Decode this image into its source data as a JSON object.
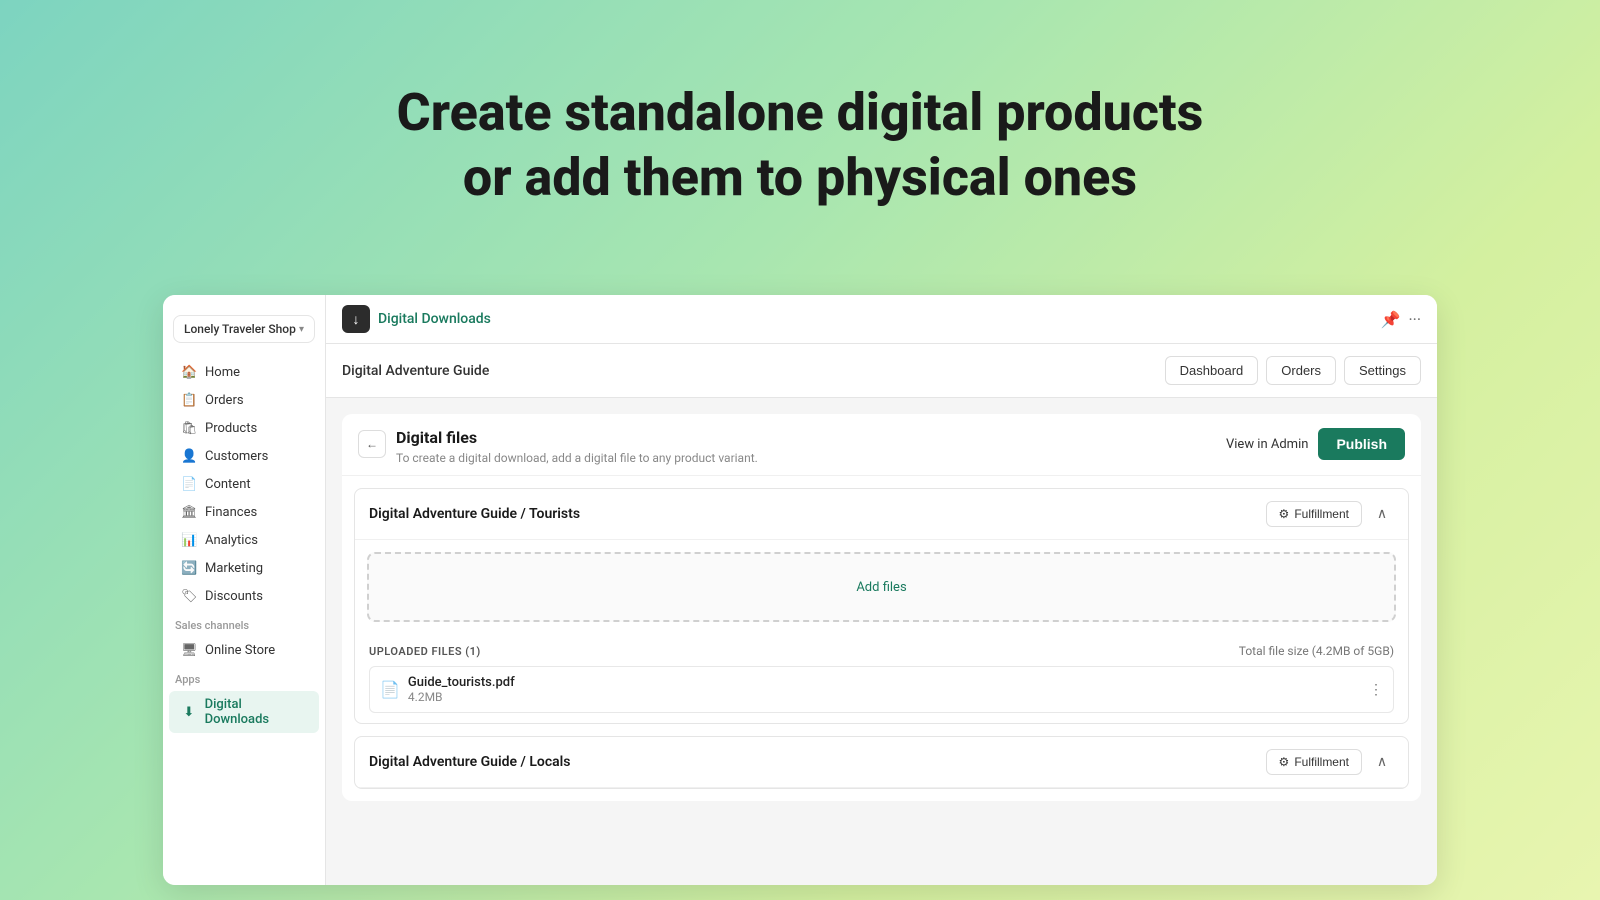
{
  "background": {
    "gradient": "linear-gradient(135deg, #7dd4c0 0%, #a8e6b0 40%, #d4f0a0 70%, #e8f5b0 100%)"
  },
  "hero": {
    "line1": "Create standalone digital products",
    "line2": "or add them to physical ones"
  },
  "sidebar": {
    "shop_name": "Lonely Traveler Shop",
    "nav_items": [
      {
        "label": "Home",
        "icon": "🏠",
        "active": false
      },
      {
        "label": "Orders",
        "icon": "📋",
        "active": false
      },
      {
        "label": "Products",
        "icon": "🛍",
        "active": false
      },
      {
        "label": "Customers",
        "icon": "👤",
        "active": false
      },
      {
        "label": "Content",
        "icon": "📄",
        "active": false
      },
      {
        "label": "Finances",
        "icon": "🏛",
        "active": false
      },
      {
        "label": "Analytics",
        "icon": "📊",
        "active": false
      },
      {
        "label": "Marketing",
        "icon": "🔄",
        "active": false
      },
      {
        "label": "Discounts",
        "icon": "🏷",
        "active": false
      }
    ],
    "sales_channels_label": "Sales channels",
    "sales_channels": [
      {
        "label": "Online Store",
        "icon": "🖥",
        "active": false
      }
    ],
    "apps_label": "Apps",
    "apps": [
      {
        "label": "Digital Downloads",
        "icon": "⬇",
        "active": true
      }
    ]
  },
  "topbar": {
    "app_icon": "⬇",
    "app_name": "Digital Downloads",
    "pin_icon": "📌",
    "more_icon": "···"
  },
  "page_header": {
    "title": "Digital Adventure Guide",
    "buttons": [
      {
        "label": "Dashboard"
      },
      {
        "label": "Orders"
      },
      {
        "label": "Settings"
      }
    ]
  },
  "digital_files": {
    "title": "Digital files",
    "subtitle": "To create a digital download, add a digital file to any product variant.",
    "view_admin_label": "View in Admin",
    "publish_label": "Publish"
  },
  "product_section_1": {
    "title": "Digital Adventure Guide / Tourists",
    "fulfillment_label": "Fulfillment",
    "add_files_label": "Add files",
    "uploaded_label": "UPLOADED FILES (1)",
    "total_size_label": "Total file size (4.2MB of 5GB)",
    "file": {
      "name": "Guide_tourists.pdf",
      "size": "4.2MB"
    }
  },
  "product_section_2": {
    "title": "Digital Adventure Guide / Locals",
    "fulfillment_label": "Fulfillment"
  }
}
